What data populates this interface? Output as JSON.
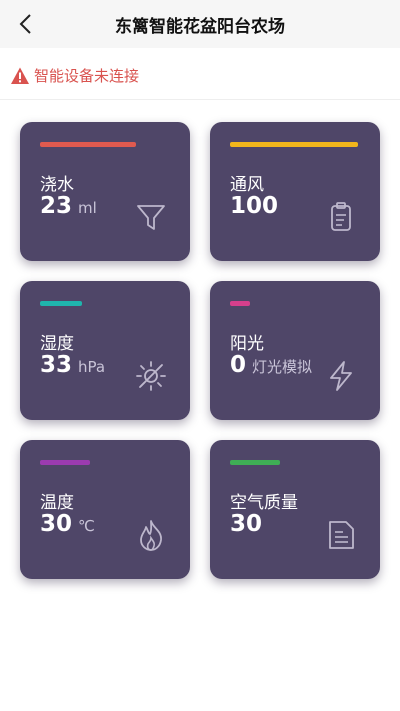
{
  "header": {
    "title": "东篱智能花盆阳台农场",
    "back_icon": "chevron-left-icon"
  },
  "status": {
    "text": "智能设备未连接",
    "icon": "warning-icon",
    "color": "#d9534f"
  },
  "cards": [
    {
      "label": "浇水",
      "value": "23",
      "unit": "ml",
      "bar_color": "#e05a4f",
      "icon": "filter-icon"
    },
    {
      "label": "通风",
      "value": "100",
      "unit": "",
      "bar_color": "#f2b61b",
      "icon": "clipboard-icon"
    },
    {
      "label": "湿度",
      "value": "33",
      "unit": "hPa",
      "bar_color": "#1fb5ad",
      "icon": "sun-icon"
    },
    {
      "label": "阳光",
      "value": "0",
      "unit": "灯光模拟",
      "bar_color": "#d63f8c",
      "icon": "lightning-icon"
    },
    {
      "label": "温度",
      "value": "30",
      "unit": "℃",
      "bar_color": "#9b3bb0",
      "icon": "flame-icon"
    },
    {
      "label": "空气质量",
      "value": "30",
      "unit": "",
      "bar_color": "#3fae55",
      "icon": "document-icon"
    }
  ]
}
